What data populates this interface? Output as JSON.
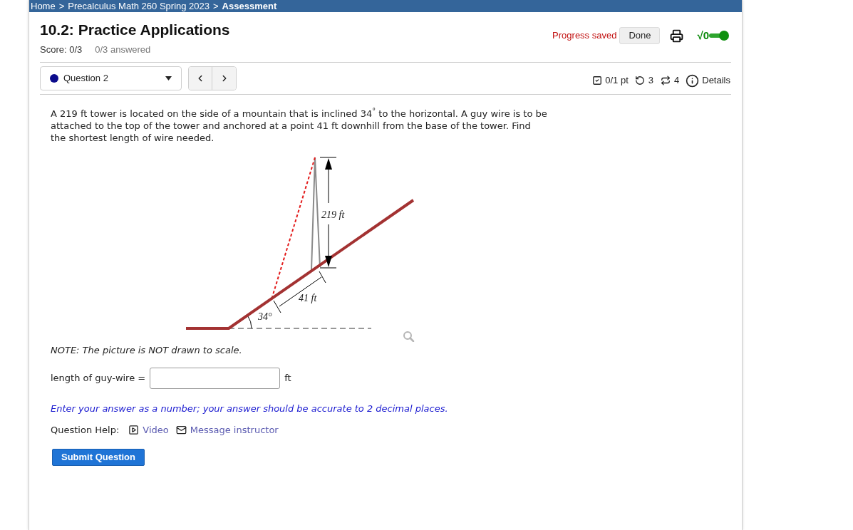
{
  "breadcrumb": {
    "separator": ">",
    "items": [
      {
        "label": "Home",
        "current": false
      },
      {
        "label": "Precalculus Math 260 Spring 2023",
        "current": false
      },
      {
        "label": "Assessment",
        "current": true
      }
    ]
  },
  "assessment": {
    "title": "10.2: Practice Applications",
    "score": "Score: 0/3",
    "answered": "0/3 answered"
  },
  "toolbar": {
    "status": "Progress saved",
    "done_button": "Done",
    "math_entry": {
      "label": "√0",
      "on": true
    }
  },
  "question_nav": {
    "question": "Question 2",
    "points": "0/1 pt",
    "attempts": "3",
    "tries": "4",
    "details": "Details"
  },
  "question": {
    "text_lines": [
      "A 219 ft tower is located on the side of a mountain that is inclined 34$^{°}$ to the horizontal. A guy wire is to be",
      "attached to the top of the tower and anchored at a point 41 ft downhill from the base of the tower. Find",
      "the shortest length of wire needed."
    ],
    "figure": {
      "height_label": "219 ft",
      "distance_label": "41 ft",
      "angle_label": "34°"
    },
    "note": "NOTE: The picture is NOT drawn to scale.",
    "answer": {
      "label": "length of guy-wire =",
      "unit": "ft"
    },
    "hint": "Enter your answer as a number; your answer should be accurate to 2 decimal places.",
    "help": {
      "label": "Question Help:",
      "links": [
        {
          "kind": "video",
          "label": "Video"
        },
        {
          "kind": "message",
          "label": "Message instructor"
        }
      ]
    },
    "submit_button": "Submit Question"
  }
}
